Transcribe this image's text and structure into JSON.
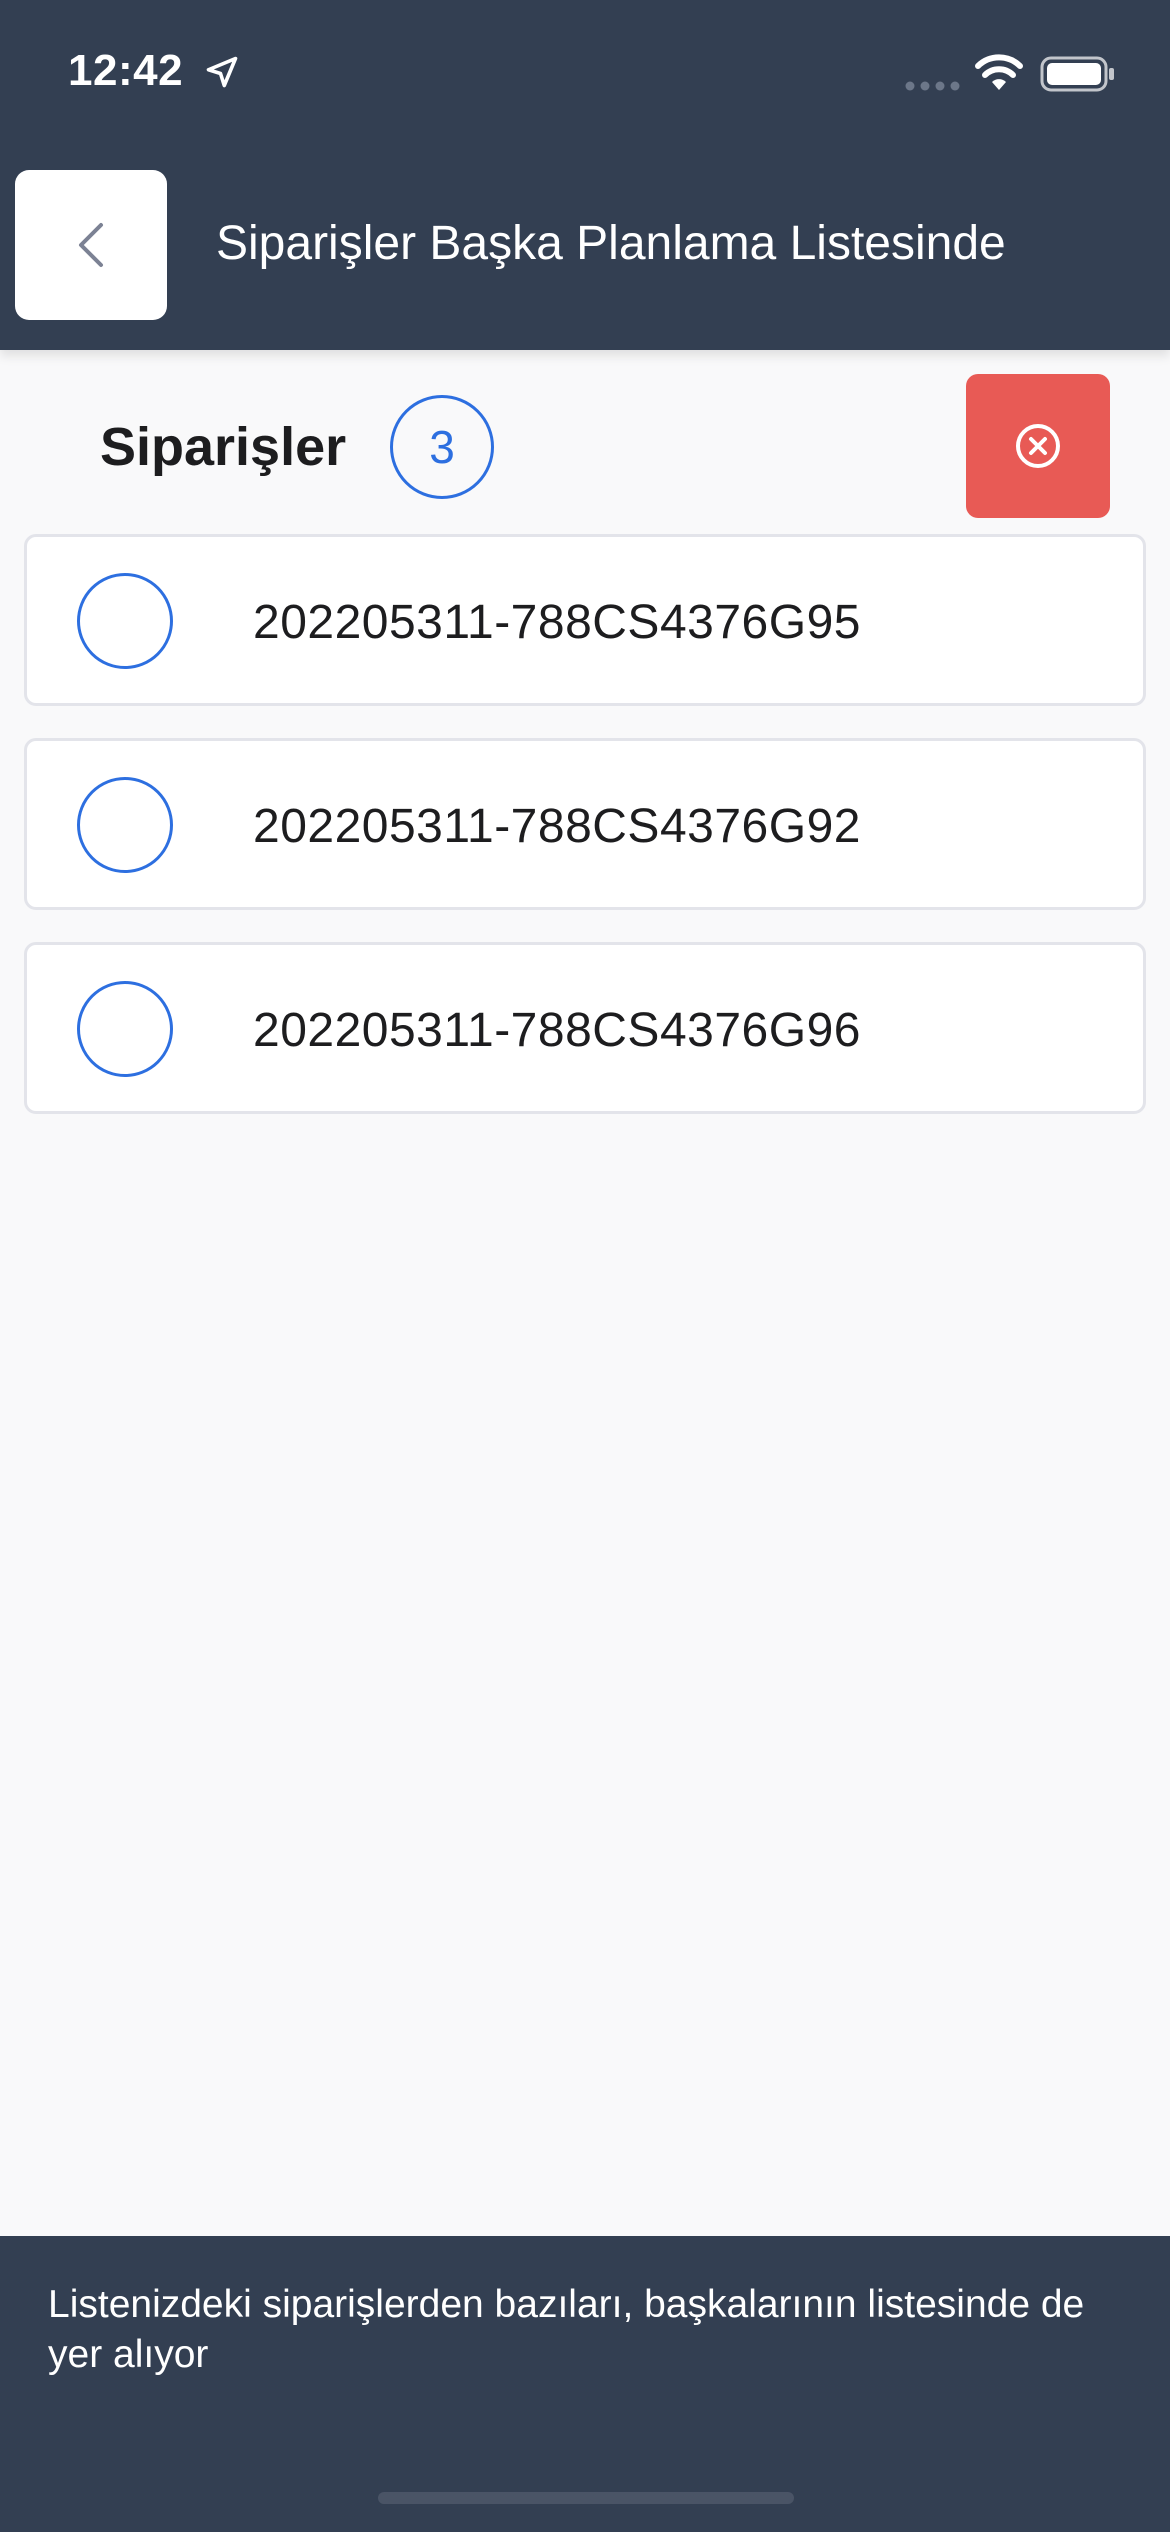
{
  "status_bar": {
    "time": "12:42",
    "icons": [
      "location-arrow-icon",
      "cellular-signal-icon",
      "wifi-icon",
      "battery-icon"
    ]
  },
  "header": {
    "title": "Siparişler Başka Planlama Listesinde",
    "back_icon": "chevron-left-icon"
  },
  "section": {
    "title": "Siparişler",
    "count": "3",
    "clear_icon": "close-circle-icon"
  },
  "orders": [
    {
      "code": "202205311-788CS4376G95",
      "selected": false
    },
    {
      "code": "202205311-788CS4376G92",
      "selected": false
    },
    {
      "code": "202205311-788CS4376G96",
      "selected": false
    }
  ],
  "footer": {
    "message": "Listenizdeki siparişlerden bazıları, başkalarının listesinde de yer alıyor"
  },
  "colors": {
    "header_bg": "#333f52",
    "accent": "#2d6fe0",
    "danger": "#e85a55",
    "page_bg": "#f9f9fa"
  }
}
